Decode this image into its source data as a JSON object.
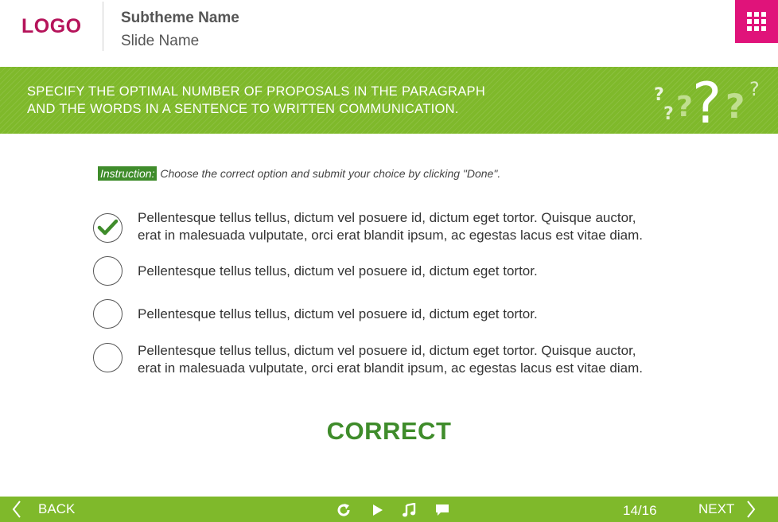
{
  "header": {
    "logo": "LOGO",
    "subtheme": "Subtheme Name",
    "slide_name": "Slide Name",
    "menu_icon": "grid-menu-icon"
  },
  "banner": {
    "text_line1": "SPECIFY THE OPTIMAL NUMBER OF PROPOSALS IN THE PARAGRAPH",
    "text_line2": "AND THE WORDS IN A SENTENCE TO WRITTEN COMMUNICATION.",
    "decoration_icon": "question-marks-icon"
  },
  "instruction": {
    "label": "Instruction:",
    "text": "Choose the correct option and submit your choice by clicking \"Done\"."
  },
  "options": [
    {
      "line1": "Pellentesque tellus tellus, dictum vel posuere id, dictum eget tortor. Quisque auctor,",
      "line2": "erat in malesuada vulputate, orci erat blandit ipsum, ac egestas lacus est vitae diam.",
      "selected": true
    },
    {
      "line1": "Pellentesque tellus tellus, dictum vel posuere id, dictum eget tortor.",
      "line2": "",
      "selected": false
    },
    {
      "line1": "Pellentesque tellus tellus, dictum vel posuere id, dictum eget tortor.",
      "line2": "",
      "selected": false
    },
    {
      "line1": "Pellentesque tellus tellus, dictum vel posuere id, dictum eget tortor. Quisque auctor,",
      "line2": "erat in malesuada vulputate, orci erat blandit ipsum, ac egestas lacus est vitae diam.",
      "selected": false
    }
  ],
  "result": "CORRECT",
  "footer": {
    "back_label": "BACK",
    "next_label": "NEXT",
    "page": "14/16",
    "controls": [
      "replay-icon",
      "play-icon",
      "music-icon",
      "comment-icon"
    ]
  },
  "colors": {
    "brand_pink": "#e0137a",
    "logo": "#b5135a",
    "green": "#7fb92b",
    "dark_green": "#3f8c2b"
  }
}
